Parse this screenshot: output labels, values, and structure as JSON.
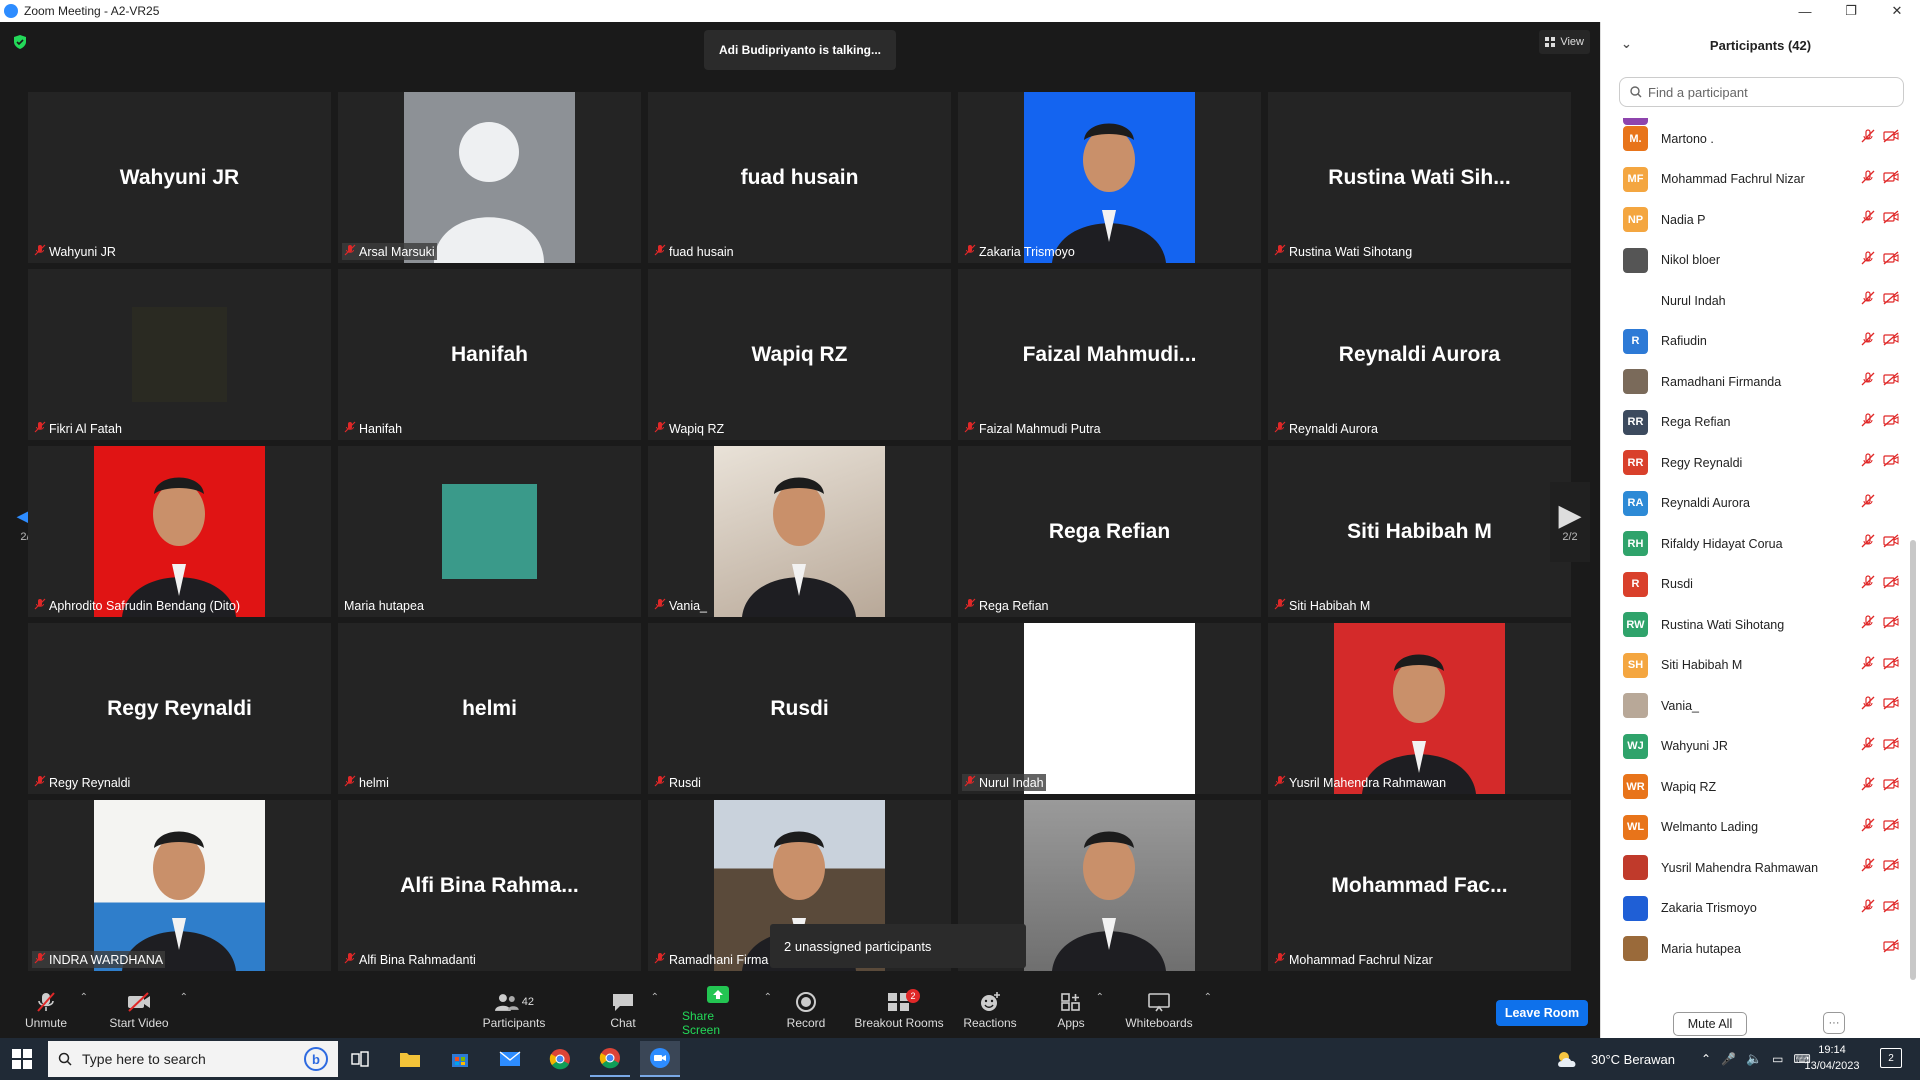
{
  "window": {
    "title": "Zoom Meeting - A2-VR25"
  },
  "meeting": {
    "talking": "Adi Budipriyanto is talking...",
    "view_label": "View",
    "page_indicator_left": "2/2",
    "page_indicator_right": "2/2",
    "unassigned": "2 unassigned participants"
  },
  "tiles": [
    {
      "big": "Wahyuni JR",
      "label": "Wahyuni JR",
      "muted": true
    },
    {
      "big": "",
      "label": "Arsal Marsuki",
      "muted": true,
      "photo": "default-avatar"
    },
    {
      "big": "fuad husain",
      "label": "fuad husain",
      "muted": true
    },
    {
      "big": "",
      "label": "Zakaria Trismoyo",
      "muted": true,
      "photo": "blue-portrait"
    },
    {
      "big": "Rustina  Wati  Sih...",
      "label": "Rustina Wati Sihotang",
      "muted": true
    },
    {
      "big": "",
      "label": "Fikri Al Fatah",
      "muted": true,
      "photo": "small-dark"
    },
    {
      "big": "Hanifah",
      "label": "Hanifah",
      "muted": true
    },
    {
      "big": "Wapiq RZ",
      "label": "Wapiq RZ",
      "muted": true
    },
    {
      "big": "Faizal  Mahmudi...",
      "label": "Faizal Mahmudi Putra",
      "muted": true
    },
    {
      "big": "Reynaldi Aurora",
      "label": "Reynaldi Aurora",
      "muted": true
    },
    {
      "big": "",
      "label": "Aphrodito Safrudin Bendang (Dito)",
      "muted": true,
      "photo": "red-portrait"
    },
    {
      "big": "",
      "label": "Maria hutapea",
      "muted": false,
      "photo": "small-piano"
    },
    {
      "big": "",
      "label": "Vania_",
      "muted": true,
      "photo": "hijab-portrait"
    },
    {
      "big": "Rega Refian",
      "label": "Rega Refian",
      "muted": true
    },
    {
      "big": "Siti Habibah M",
      "label": "Siti Habibah M",
      "muted": true
    },
    {
      "big": "Regy Reynaldi",
      "label": "Regy Reynaldi",
      "muted": true
    },
    {
      "big": "helmi",
      "label": "helmi",
      "muted": true
    },
    {
      "big": "Rusdi",
      "label": "Rusdi",
      "muted": true
    },
    {
      "big": "",
      "label": "Nurul Indah",
      "muted": true,
      "photo": "white"
    },
    {
      "big": "",
      "label": "Yusril Mahendra Rahmawan",
      "muted": true,
      "photo": "red-portrait-2"
    },
    {
      "big": "",
      "label": "INDRA WARDHANA",
      "muted": true,
      "photo": "blue-shirt"
    },
    {
      "big": "Alfi  Bina  Rahma...",
      "label": "Alfi Bina Rahmadanti",
      "muted": true
    },
    {
      "big": "",
      "label": "Ramadhani Firma",
      "muted": true,
      "photo": "motorbike"
    },
    {
      "big": "",
      "label": "",
      "muted": false,
      "photo": "grey-sitting"
    },
    {
      "big": "Mohammad  Fac...",
      "label": "Mohammad Fachrul Nizar",
      "muted": true
    }
  ],
  "toolbar": {
    "unmute": "Unmute",
    "start_video": "Start Video",
    "participants": "Participants",
    "participants_count": "42",
    "chat": "Chat",
    "share_screen": "Share Screen",
    "record": "Record",
    "breakout_rooms": "Breakout Rooms",
    "breakout_badge": "2",
    "reactions": "Reactions",
    "apps": "Apps",
    "whiteboards": "Whiteboards",
    "leave_room": "Leave Room"
  },
  "panel": {
    "title": "Participants (42)",
    "search_placeholder": "Find a participant",
    "mute_all": "Mute All",
    "more": "···",
    "participants": [
      {
        "initials": "M.",
        "name": "Martono .",
        "color": "#e8741a",
        "video_off": true
      },
      {
        "initials": "MF",
        "name": "Mohammad Fachrul Nizar",
        "color": "#f4a640",
        "video_off": true
      },
      {
        "initials": "NP",
        "name": "Nadia P",
        "color": "#f4a640",
        "video_off": true
      },
      {
        "initials": "",
        "name": "Nikol bloer",
        "color": "#555555",
        "video_off": true
      },
      {
        "initials": "",
        "name": "Nurul Indah",
        "color": "#ffffff",
        "video_off": true
      },
      {
        "initials": "R",
        "name": "Rafiudin",
        "color": "#2d7ad6",
        "video_off": true
      },
      {
        "initials": "",
        "name": "Ramadhani Firmanda",
        "color": "#7a6a5a",
        "video_off": true
      },
      {
        "initials": "RR",
        "name": "Rega Refian",
        "color": "#3c4a5e",
        "video_off": true
      },
      {
        "initials": "RR",
        "name": "Regy Reynaldi",
        "color": "#d9402b",
        "video_off": true
      },
      {
        "initials": "RA",
        "name": "Reynaldi Aurora",
        "color": "#2d8ad6",
        "video_off": false
      },
      {
        "initials": "RH",
        "name": "Rifaldy Hidayat Corua",
        "color": "#2fa36b",
        "video_off": true
      },
      {
        "initials": "R",
        "name": "Rusdi",
        "color": "#d9402b",
        "video_off": true
      },
      {
        "initials": "RW",
        "name": "Rustina Wati Sihotang",
        "color": "#2fa36b",
        "video_off": true
      },
      {
        "initials": "SH",
        "name": "Siti Habibah M",
        "color": "#f4a640",
        "video_off": true
      },
      {
        "initials": "",
        "name": "Vania_",
        "color": "#b8a898",
        "video_off": true
      },
      {
        "initials": "WJ",
        "name": "Wahyuni JR",
        "color": "#2fa36b",
        "video_off": true
      },
      {
        "initials": "WR",
        "name": "Wapiq RZ",
        "color": "#e8741a",
        "video_off": true
      },
      {
        "initials": "WL",
        "name": "Welmanto Lading",
        "color": "#e8741a",
        "video_off": true
      },
      {
        "initials": "",
        "name": "Yusril Mahendra Rahmawan",
        "color": "#c03a2b",
        "video_off": true
      },
      {
        "initials": "",
        "name": "Zakaria Trismoyo",
        "color": "#1f5fd6",
        "video_off": true
      },
      {
        "initials": "",
        "name": "Maria hutapea",
        "color": "#9a6a3a",
        "video_off": true,
        "mic_on": true
      }
    ]
  },
  "taskbar": {
    "search_placeholder": "Type here to search",
    "weather": "30°C  Berawan",
    "time": "19:14",
    "date": "13/04/2023",
    "notifications": "2"
  }
}
